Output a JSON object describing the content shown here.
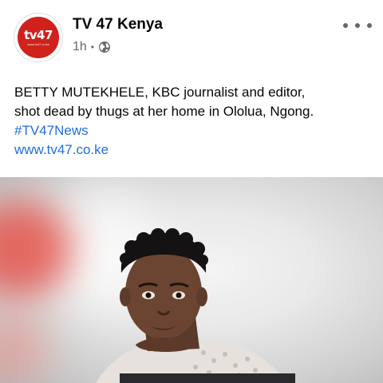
{
  "post": {
    "page_name": "TV 47 Kenya",
    "time": "1h",
    "separator": "•",
    "text_lines": [
      "BETTY MUTEKHELE, KBC journalist and editor,",
      "shot dead by thugs at her home in Ololua, Ngong."
    ],
    "hashtag": "#TV47News",
    "link": "www.tv47.co.ke"
  },
  "avatar": {
    "logo_text": "tv47",
    "logo_sub": "www.tv47.co.ke"
  },
  "icons": {
    "privacy": "globe-icon",
    "more": "more-options-icon"
  },
  "colors": {
    "brand_red": "#d0211c",
    "link_blue": "#216fdb",
    "meta_gray": "#65676b"
  }
}
